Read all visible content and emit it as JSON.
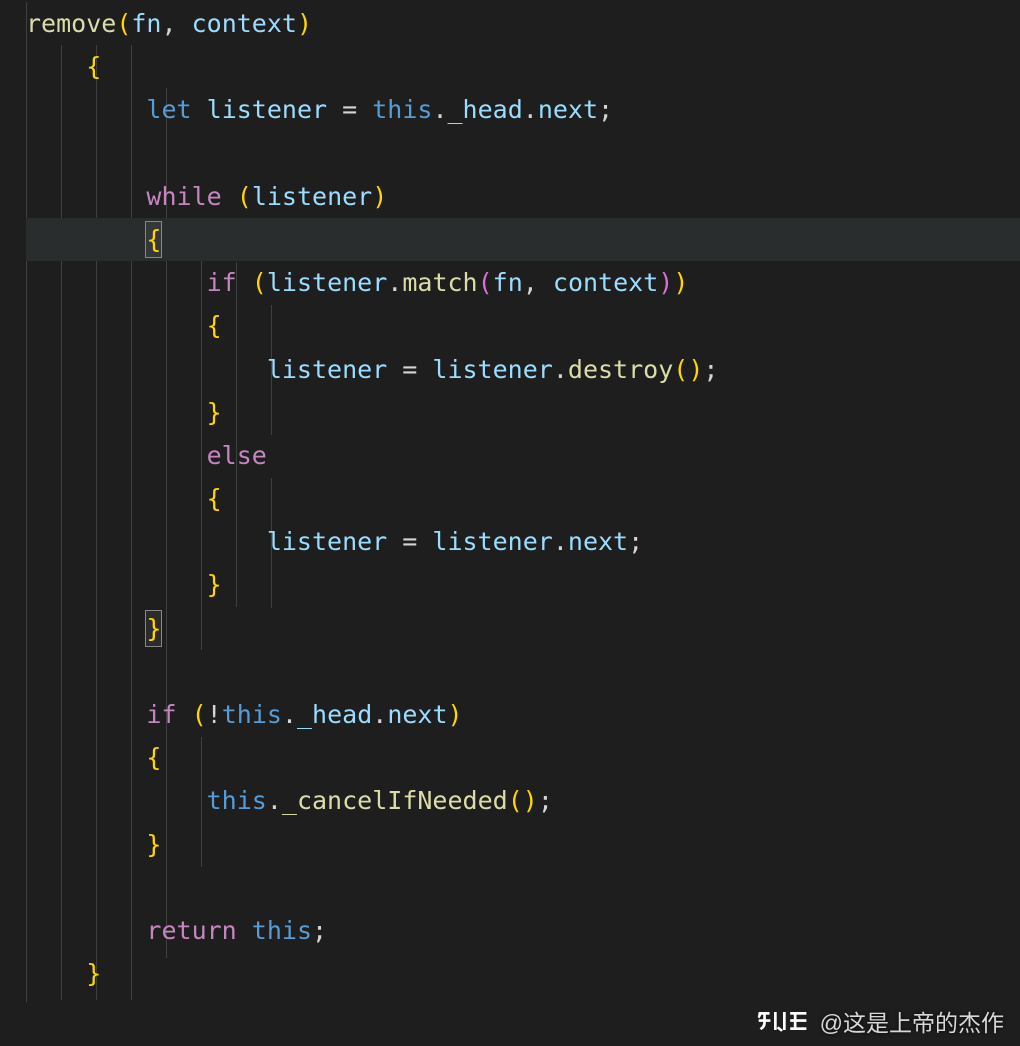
{
  "code": {
    "line1": {
      "fn": "remove",
      "p1": "fn",
      "p2": "context"
    },
    "line3": {
      "kw": "let",
      "v": "listener",
      "eq": " = ",
      "th": "this",
      "d1": ".",
      "p1": "_head",
      "d2": ".",
      "p2": "next",
      "semi": ";"
    },
    "line5": {
      "kw": "while",
      "sp": " ",
      "lp": "(",
      "v": "listener",
      "rp": ")"
    },
    "line6": {
      "ob": "{"
    },
    "line7": {
      "kw": "if",
      "sp": " ",
      "lp1": "(",
      "v": "listener",
      "dot": ".",
      "m": "match",
      "lp2": "(",
      "a1": "fn",
      "comma": ", ",
      "a2": "context",
      "rp2": ")",
      "rp1": ")"
    },
    "line8": {
      "ob": "{"
    },
    "line9": {
      "v1": "listener",
      "eq": " = ",
      "v2": "listener",
      "dot": ".",
      "m": "destroy",
      "lp": "(",
      "rp": ")",
      "semi": ";"
    },
    "line10": {
      "cb": "}"
    },
    "line11": {
      "kw": "else"
    },
    "line12": {
      "ob": "{"
    },
    "line13": {
      "v1": "listener",
      "eq": " = ",
      "v2": "listener",
      "dot": ".",
      "p": "next",
      "semi": ";"
    },
    "line14": {
      "cb": "}"
    },
    "line15": {
      "cb": "}"
    },
    "line17": {
      "kw": "if",
      "sp": " ",
      "lp": "(",
      "not": "!",
      "th": "this",
      "d1": ".",
      "p1": "_head",
      "d2": ".",
      "p2": "next",
      "rp": ")"
    },
    "line18": {
      "ob": "{"
    },
    "line19": {
      "th": "this",
      "dot": ".",
      "m": "_cancelIfNeeded",
      "lp": "(",
      "rp": ")",
      "semi": ";"
    },
    "line20": {
      "cb": "}"
    },
    "line22": {
      "kw": "return",
      "sp": " ",
      "th": "this",
      "semi": ";"
    },
    "line23": {
      "cb": "}"
    }
  },
  "watermark": {
    "site": "知乎",
    "user": "@这是上帝的杰作"
  }
}
